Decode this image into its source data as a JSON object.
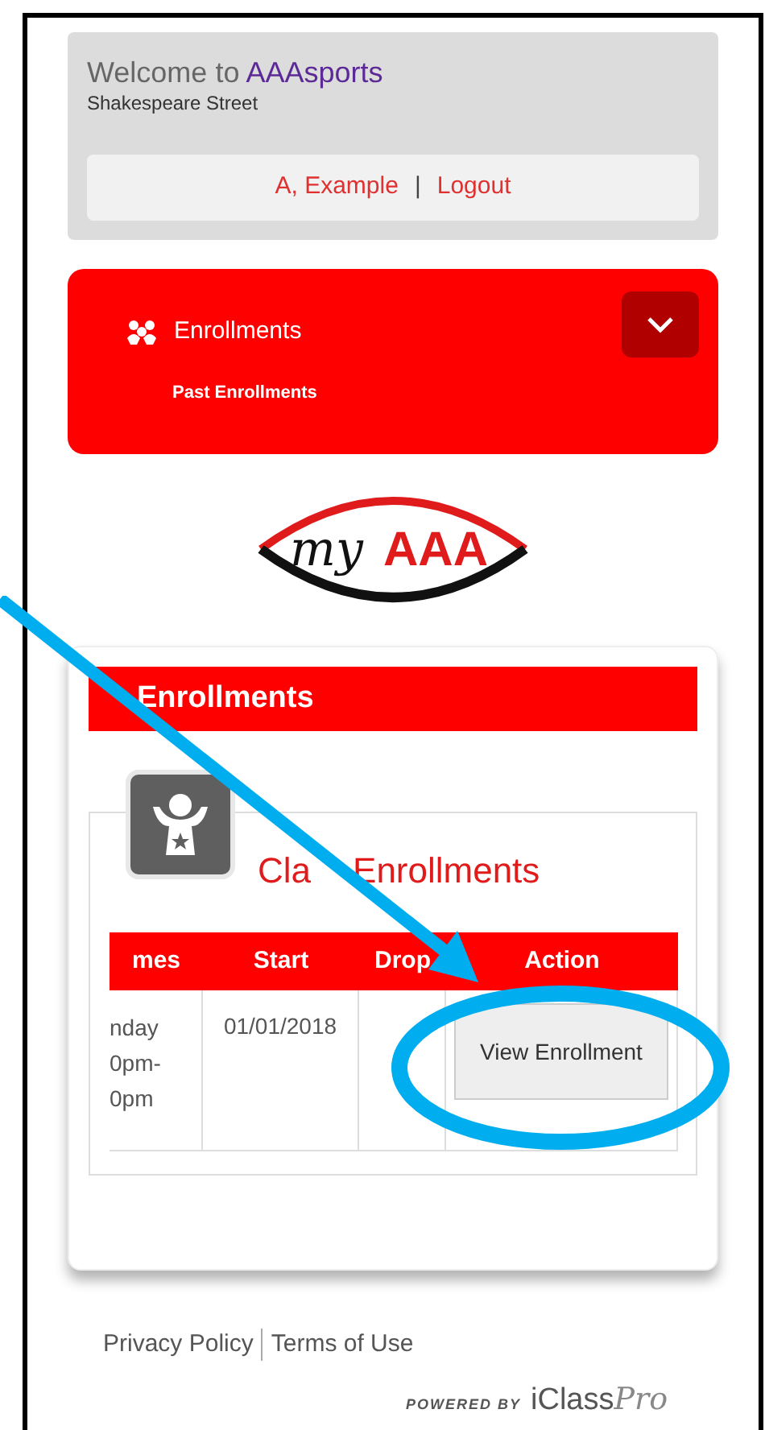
{
  "header": {
    "welcome": "Welcome to",
    "brand": "AAAsports",
    "location": "Shakespeare Street",
    "user_link": "A, Example",
    "separator": "|",
    "logout_link": "Logout"
  },
  "menu": {
    "title": "Enrollments",
    "expanded": true,
    "items": [
      "Past Enrollments"
    ]
  },
  "logo": {
    "script": "my",
    "letters": "AAA"
  },
  "section": {
    "title": "Enrollments",
    "subtitle": [
      "Cla",
      "Enrollments"
    ],
    "table": {
      "columns": [
        "mes",
        "Start",
        "Drop",
        "Action"
      ],
      "rows": [
        {
          "times": [
            "nday",
            "0pm-",
            "0pm"
          ],
          "start": "01/01/2018",
          "action": "View Enrollment"
        }
      ]
    }
  },
  "footer": {
    "links": [
      "Privacy Policy",
      "Terms of Use"
    ],
    "powered_by": "POWERED BY",
    "vendor": "iClass",
    "vendor_script": "Pro"
  }
}
